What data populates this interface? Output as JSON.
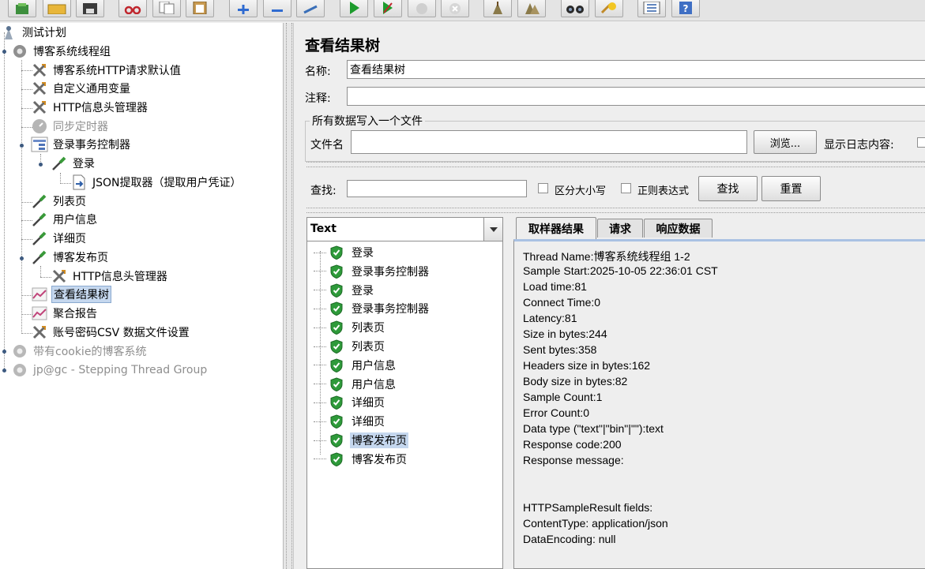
{
  "toolbar": {
    "icons": [
      "templates-icon",
      "open-icon",
      "save-icon",
      "cut-icon",
      "copy-icon",
      "paste-icon",
      "expand-icon",
      "collapse-icon",
      "toggle-icon",
      "start-icon",
      "start-no-pause-icon",
      "stop-icon",
      "shutdown-icon",
      "clear-icon",
      "clear-all-icon",
      "search-icon",
      "reset-search-icon",
      "function-helper-icon",
      "help-icon"
    ]
  },
  "tree": {
    "items": [
      {
        "label": "测试计划",
        "icon": "test-plan-icon"
      },
      {
        "label": "博客系统线程组",
        "icon": "thread-group-icon"
      },
      {
        "label": "博客系统HTTP请求默认值",
        "icon": "config-element-icon"
      },
      {
        "label": "自定义通用变量",
        "icon": "config-element-icon"
      },
      {
        "label": "HTTP信息头管理器",
        "icon": "config-element-icon"
      },
      {
        "label": "同步定时器",
        "icon": "timer-icon"
      },
      {
        "label": "登录事务控制器",
        "icon": "transaction-controller-icon"
      },
      {
        "label": "登录",
        "icon": "sampler-icon"
      },
      {
        "label": "JSON提取器（提取用户凭证）",
        "icon": "post-processor-icon"
      },
      {
        "label": "列表页",
        "icon": "sampler-icon"
      },
      {
        "label": "用户信息",
        "icon": "sampler-icon"
      },
      {
        "label": "详细页",
        "icon": "sampler-icon"
      },
      {
        "label": "博客发布页",
        "icon": "sampler-icon"
      },
      {
        "label": "HTTP信息头管理器",
        "icon": "config-element-icon"
      },
      {
        "label": "查看结果树",
        "icon": "listener-icon"
      },
      {
        "label": "聚合报告",
        "icon": "listener-icon"
      },
      {
        "label": "账号密码CSV 数据文件设置",
        "icon": "config-element-icon"
      },
      {
        "label": "带有cookie的博客系统",
        "icon": "thread-group-icon"
      },
      {
        "label": "jp@gc - Stepping Thread Group",
        "icon": "thread-group-icon"
      }
    ]
  },
  "panel": {
    "title": "查看结果树",
    "name_label": "名称:",
    "name_value": "查看结果树",
    "comment_label": "注释:",
    "comment_value": "",
    "file_group_title": "所有数据写入一个文件",
    "filename_label": "文件名",
    "filename_value": "",
    "browse_button": "浏览...",
    "log_content_label": "显示日志内容:"
  },
  "search": {
    "label": "查找:",
    "value": "",
    "case_sensitive_label": "区分大小写",
    "regex_label": "正则表达式",
    "search_button": "查找",
    "reset_button": "重置"
  },
  "results": {
    "renderer": "Text",
    "items": [
      "登录",
      "登录事务控制器",
      "登录",
      "登录事务控制器",
      "列表页",
      "列表页",
      "用户信息",
      "用户信息",
      "详细页",
      "详细页",
      "博客发布页",
      "博客发布页"
    ],
    "selected_index": 10
  },
  "tabs": [
    "取样器结果",
    "请求",
    "响应数据"
  ],
  "details": [
    "Thread Name:博客系统线程组 1-2",
    "Sample Start:2025-10-05 22:36:01 CST",
    "Load time:81",
    "Connect Time:0",
    "Latency:81",
    "Size in bytes:244",
    "Sent bytes:358",
    "Headers size in bytes:162",
    "Body size in bytes:82",
    "Sample Count:1",
    "Error Count:0",
    "Data type (\"text\"|\"bin\"|\"\"):text",
    "Response code:200",
    "Response message:",
    "",
    "",
    "HTTPSampleResult fields:",
    "ContentType: application/json",
    "DataEncoding: null"
  ],
  "colors": {
    "selection": "#c5d7ee",
    "tab_accent": "#a9c1e3",
    "success_shield": "#2e9a3a"
  }
}
